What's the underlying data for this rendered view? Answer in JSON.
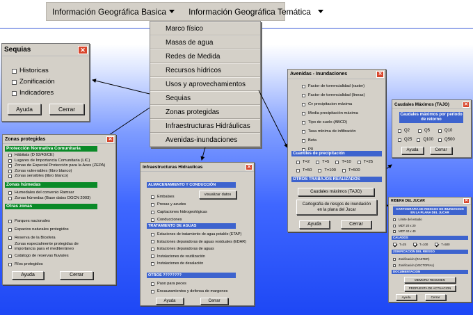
{
  "menubar": {
    "item1": "Información Geográfica Basica",
    "item2": "Información Geográfica Temática"
  },
  "dropdown": [
    "Marco físico",
    "Masas de agua",
    "Redes de Medida",
    "Recursos hídricos",
    "Usos y aprovechamientos",
    "Sequias",
    "Zonas protegidas",
    "Infraestructuras Hidráulicas",
    "Avenidas-inundaciones"
  ],
  "sequias": {
    "title": "Sequias",
    "items": [
      "Historicas",
      "Zonificación",
      "Indicadores"
    ],
    "ok": "Ayuda",
    "cancel": "Cerrar"
  },
  "zonas": {
    "title": "Zonas protegidas",
    "h1": "Protección Normativa Comunitaria",
    "g1": [
      "Hábitats (D 92/43/CE)",
      "Lugares de Importancia Comunitaria (LIC)",
      "Zonas de Especial Protección para la Aves (ZEPA)",
      "Zonas vulnerables (libro blanco)",
      "Zonas sensibles (libro blanco)"
    ],
    "h2": "Zonas húmedas",
    "g2": [
      "Humedales del convenio Ramsar",
      "Zonas húmedas (Base datos DGCN 2003)"
    ],
    "h3": "Otras zonas",
    "g3": [
      "Parques nacionales",
      "Espacios naturales protegidos",
      "Reserva de la Biosfera",
      "Zonas especialmente protegidas de",
      "importancia para el mediterráneo",
      "Catálogo de reservas fluviales",
      "Ríos protegidos"
    ],
    "ok": "Ayuda",
    "cancel": "Cerrar"
  },
  "infra": {
    "title": "Infraestructuras Hidraulicas",
    "h1": "ALMACENAMIENTO Y CONDUCCIÓN",
    "g1": [
      "Embalses",
      "Presas y azudes",
      "Captaciones hidrogeológicas",
      "Conducciones"
    ],
    "vis": "visualizar  datos",
    "h2": "TRATAMIENTO DE AGUAS",
    "g2": [
      "Estaciones de tratamiento de agua potable (ETAP)",
      "Estaciones depuradoras de aguas residuales (EDAR)",
      "Estaciones depuradoras de aguas",
      "Instalaciones de reutilización",
      "Instalaciones de desalación"
    ],
    "h3": "OTROS ????????",
    "g3": [
      "Paso para peces",
      "Encauzamientos y defensa de margenes"
    ],
    "ok": "Ayuda",
    "cancel": "Cerrar"
  },
  "avenidas": {
    "title": "Avenidas - Inundaciones",
    "items": [
      "Factor de torrencialidad (raster)",
      "Factor de torrencialidad (lineas)",
      "Cv precipitacion máxima",
      "Media precipitación máxima",
      "Tipo de suelo (ABCD)",
      "Tasa mínima de infiltración",
      "Beta",
      "P0"
    ],
    "h1": "Cuantiles de precipitación",
    "t1": [
      "T=2",
      "T=5",
      "T=10",
      "T=25"
    ],
    "t2": [
      "T=50",
      "T=100",
      "T=500"
    ],
    "h2": "OTROS TRABAJOS REALIZADOS",
    "b1": "Caudales máximos (TAJO)",
    "b2": "Cartografía de riesgos de inundación en la plana del Jucar",
    "ok": "Ayuda",
    "cancel": "Cerrar"
  },
  "caudales": {
    "title": "Caudales Máximos (TAJO)",
    "head": "Caudales máximos por periodo de retorno",
    "r1": [
      "Q2",
      "Q5",
      "Q10"
    ],
    "r2": [
      "Q25",
      "Q100",
      "Q500"
    ],
    "ok": "Ayuda",
    "cancel": "Cerrar"
  },
  "ribera": {
    "title": "RIBERA DEL JUCAR",
    "head": "CARTOGRAFIA DE RIESGOS DE INUNDACION EN LA PLANA DEL JUCAR",
    "g1": [
      "Límite del estudio",
      "MDT 20 x 20",
      "MDT 40 x 40"
    ],
    "h2": "CALADOS",
    "t": [
      "T=25",
      "T=100",
      "T=500"
    ],
    "h3": "ZONIFICACION DEL RIESGO",
    "g3": [
      "Zonificación (RASTER)",
      "Zonificación (VECTORIAL)"
    ],
    "h4": "DOCUMENTACION",
    "b1": "MEMORIA RESUMEN",
    "b2": "PROPUESTA DE ACTUACION",
    "ok": "Ayuda",
    "cancel": "Cerrar"
  }
}
